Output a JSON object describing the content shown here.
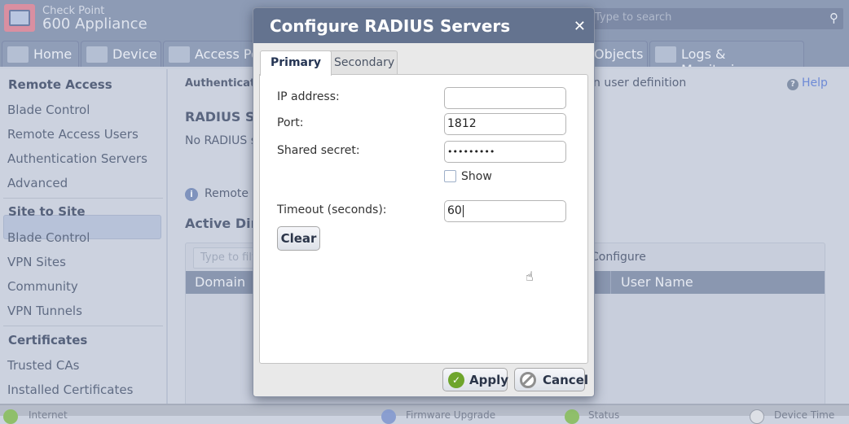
{
  "app": {
    "brand_line1": "Check Point",
    "brand_line2": "600 Appliance",
    "search_placeholder": "Type to search"
  },
  "nav_tabs": [
    {
      "label": "Home",
      "icon": "home-icon"
    },
    {
      "label": "Device",
      "icon": "device-icon"
    },
    {
      "label": "Access Policy",
      "icon": "access-policy-icon"
    },
    {
      "label": "Objects",
      "icon": "objects-icon"
    },
    {
      "label": "Logs & Monitoring",
      "icon": "logs-icon"
    }
  ],
  "sidebar": {
    "sections": [
      {
        "title": "Remote Access",
        "items": [
          "Blade Control",
          "Remote Access Users",
          "Authentication Servers",
          "Advanced"
        ]
      },
      {
        "title": "Site to Site",
        "items": [
          "Blade Control",
          "VPN Sites",
          "Community",
          "VPN Tunnels"
        ]
      },
      {
        "title": "Certificates",
        "items": [
          "Trusted CAs",
          "Installed Certificates"
        ]
      }
    ],
    "selected": "Authentication Servers"
  },
  "main": {
    "breadcrumb": "Authentication Servers",
    "breadcrumb_tail": "n user definition",
    "help": "Help",
    "radius_title": "RADIUS Servers",
    "radius_status": "No RADIUS servers",
    "info_text": "Remote a",
    "ad_title": "Active Directory",
    "filter_placeholder": "Type to filter",
    "configure_label": "Configure",
    "table_headers": [
      "Domain",
      "User Name"
    ]
  },
  "statusbar": {
    "items": [
      "Internet",
      "Firmware Upgrade",
      "Status",
      "Device Time"
    ]
  },
  "dialog": {
    "title": "Configure RADIUS Servers",
    "tabs": [
      "Primary",
      "Secondary"
    ],
    "active_tab": "Primary",
    "fields": {
      "ip_label": "IP address:",
      "ip_value": "",
      "port_label": "Port:",
      "port_value": "1812",
      "secret_label": "Shared secret:",
      "secret_value": "•••••••••",
      "show_label": "Show",
      "show_checked": false,
      "timeout_label": "Timeout (seconds):",
      "timeout_value": "60"
    },
    "clear_label": "Clear",
    "apply_label": "Apply",
    "cancel_label": "Cancel"
  }
}
